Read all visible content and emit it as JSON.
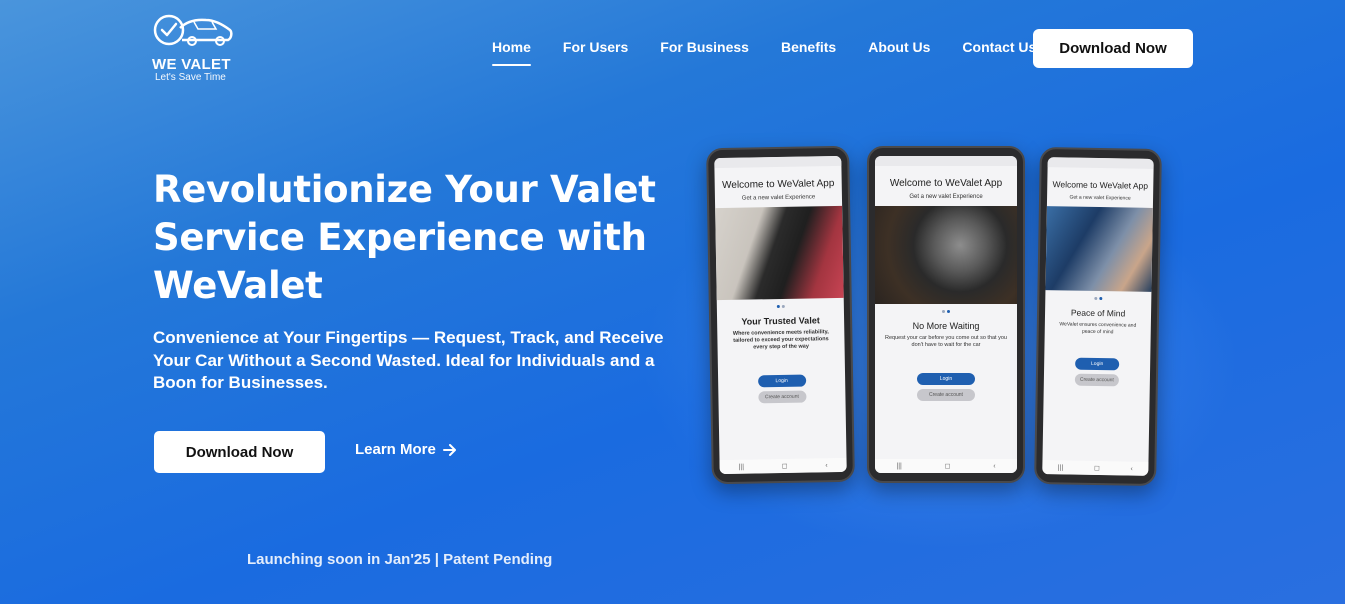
{
  "header": {
    "logo": {
      "name": "WE VALET",
      "tagline": "Let's Save Time"
    },
    "nav": [
      {
        "label": "Home",
        "active": true
      },
      {
        "label": "For Users",
        "active": false
      },
      {
        "label": "For Business",
        "active": false
      },
      {
        "label": "Benefits",
        "active": false
      },
      {
        "label": "About Us",
        "active": false
      },
      {
        "label": "Contact Us",
        "active": false
      }
    ],
    "download_label": "Download Now"
  },
  "hero": {
    "title": "Revolutionize Your Valet Service Experience with WeValet",
    "subtitle": "Convenience at Your Fingertips — Request, Track, and Receive Your Car Without a Second Wasted. Ideal for Individuals and a Boon for Businesses.",
    "download_label": "Download Now",
    "learn_more_label": "Learn More",
    "launch_text": "Launching soon in Jan'25 | Patent Pending"
  },
  "phones": [
    {
      "app_title": "Welcome to WeValet App",
      "app_sub": "Get a new valet Experience",
      "heading": "Your Trusted Valet",
      "text": "Where convenience meets reliability, tailored to exceed your expectations every step of the way",
      "login": "Login",
      "create": "Create account"
    },
    {
      "app_title": "Welcome to WeValet App",
      "app_sub": "Get a new valet Experience",
      "heading": "No More Waiting",
      "text": "Request your car before you come out so that you don't have to wait for the car",
      "login": "Login",
      "create": "Create account"
    },
    {
      "app_title": "Welcome to WeValet App",
      "app_sub": "Get a new valet Experience",
      "heading": "Peace of Mind",
      "text": "WeValet ensures convenience and peace of mind",
      "login": "Login",
      "create": "Create account"
    }
  ]
}
